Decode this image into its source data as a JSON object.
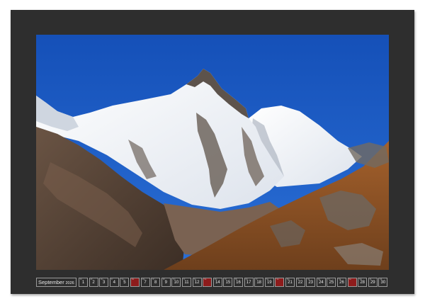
{
  "calendar": {
    "month": "September",
    "year": "2026",
    "days": [
      {
        "n": "1",
        "wd": "Di",
        "sunday": false
      },
      {
        "n": "2",
        "wd": "Mi",
        "sunday": false
      },
      {
        "n": "3",
        "wd": "Do",
        "sunday": false
      },
      {
        "n": "4",
        "wd": "Fr",
        "sunday": false
      },
      {
        "n": "5",
        "wd": "Sa",
        "sunday": false
      },
      {
        "n": "6",
        "wd": "So",
        "sunday": true
      },
      {
        "n": "7",
        "wd": "Mo",
        "sunday": false
      },
      {
        "n": "8",
        "wd": "Di",
        "sunday": false
      },
      {
        "n": "9",
        "wd": "Mi",
        "sunday": false
      },
      {
        "n": "10",
        "wd": "Do",
        "sunday": false
      },
      {
        "n": "11",
        "wd": "Fr",
        "sunday": false
      },
      {
        "n": "12",
        "wd": "Sa",
        "sunday": false
      },
      {
        "n": "13",
        "wd": "So",
        "sunday": true
      },
      {
        "n": "14",
        "wd": "Mo",
        "sunday": false
      },
      {
        "n": "15",
        "wd": "Di",
        "sunday": false
      },
      {
        "n": "16",
        "wd": "Mi",
        "sunday": false
      },
      {
        "n": "17",
        "wd": "Do",
        "sunday": false
      },
      {
        "n": "18",
        "wd": "Fr",
        "sunday": false
      },
      {
        "n": "19",
        "wd": "Sa",
        "sunday": false
      },
      {
        "n": "20",
        "wd": "So",
        "sunday": true
      },
      {
        "n": "21",
        "wd": "Mo",
        "sunday": false
      },
      {
        "n": "22",
        "wd": "Di",
        "sunday": false
      },
      {
        "n": "23",
        "wd": "Mi",
        "sunday": false
      },
      {
        "n": "24",
        "wd": "Do",
        "sunday": false
      },
      {
        "n": "25",
        "wd": "Fr",
        "sunday": false
      },
      {
        "n": "26",
        "wd": "Sa",
        "sunday": false
      },
      {
        "n": "27",
        "wd": "So",
        "sunday": true
      },
      {
        "n": "28",
        "wd": "Mo",
        "sunday": false
      },
      {
        "n": "29",
        "wd": "Di",
        "sunday": false
      },
      {
        "n": "30",
        "wd": "Mi",
        "sunday": false
      }
    ]
  },
  "colors": {
    "frame": "#2e2e2e",
    "sky": "#1c5fc8",
    "snow": "#f2f4f8",
    "rock": "#6d5a4a",
    "slope": "#9a5a28",
    "sunday": "#8e1c1c"
  },
  "photo": {
    "subject": "mountain-photo"
  }
}
